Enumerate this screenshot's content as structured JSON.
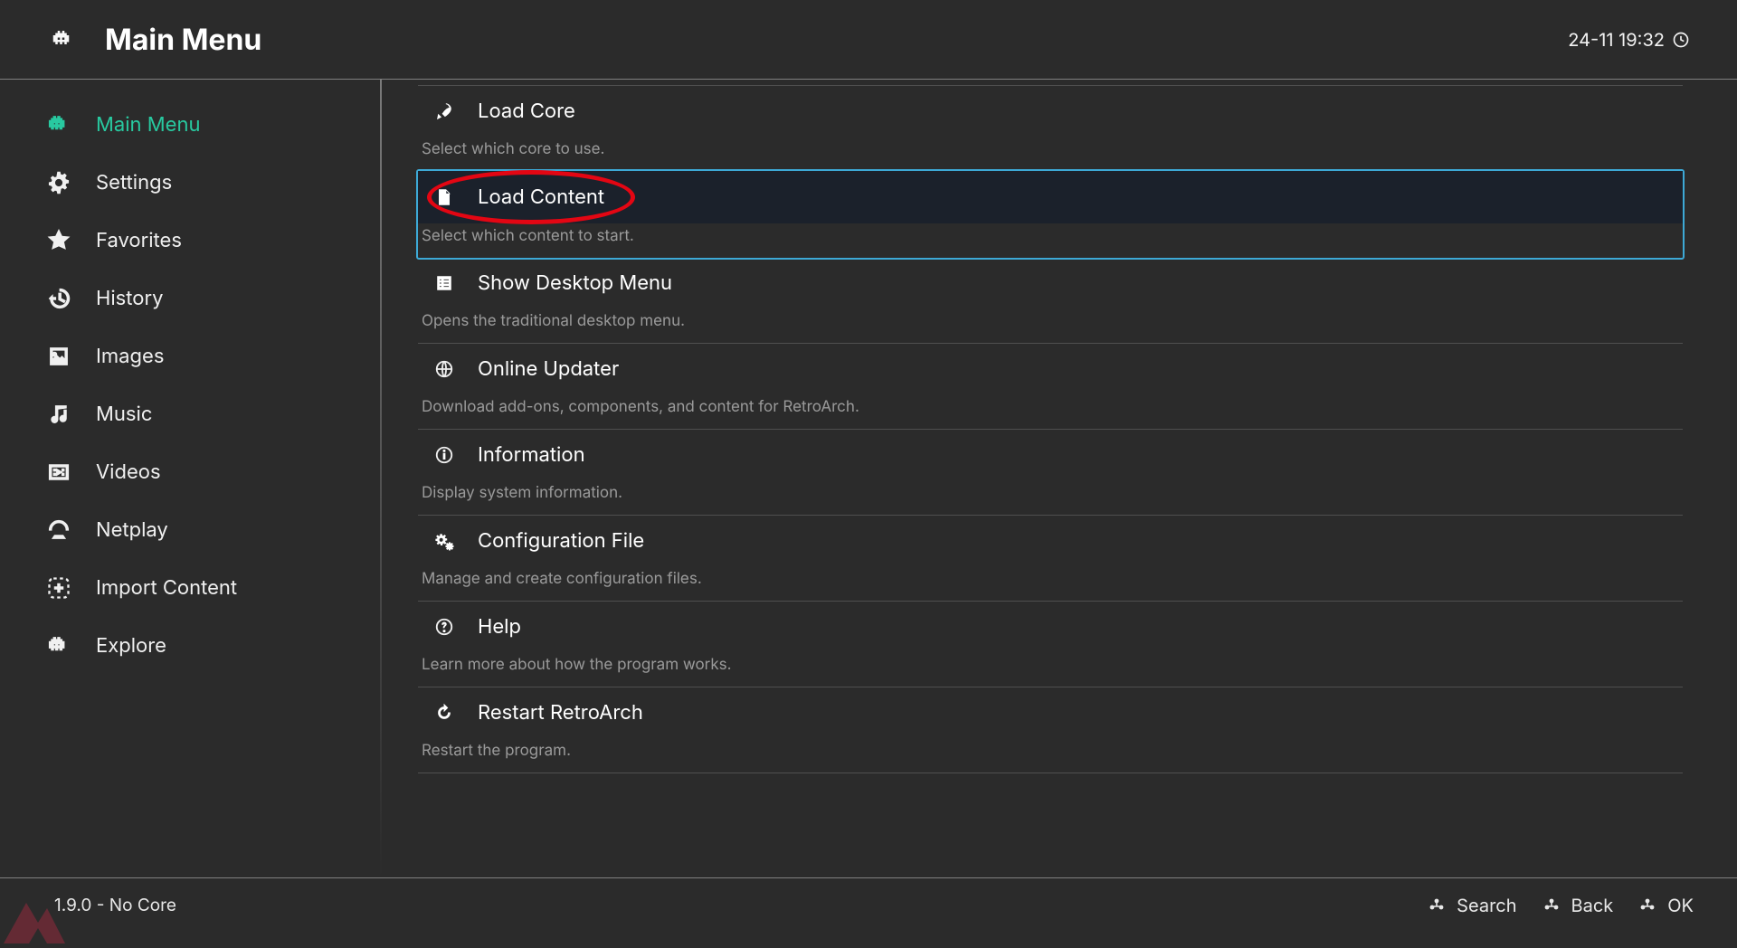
{
  "header": {
    "title": "Main Menu",
    "datetime": "24-11 19:32"
  },
  "sidebar": {
    "items": [
      {
        "label": "Main Menu",
        "icon": "invader-icon",
        "active": true
      },
      {
        "label": "Settings",
        "icon": "gear-icon",
        "active": false
      },
      {
        "label": "Favorites",
        "icon": "star-icon",
        "active": false
      },
      {
        "label": "History",
        "icon": "history-icon",
        "active": false
      },
      {
        "label": "Images",
        "icon": "image-icon",
        "active": false
      },
      {
        "label": "Music",
        "icon": "music-icon",
        "active": false
      },
      {
        "label": "Videos",
        "icon": "video-icon",
        "active": false
      },
      {
        "label": "Netplay",
        "icon": "netplay-icon",
        "active": false
      },
      {
        "label": "Import Content",
        "icon": "plus-box-icon",
        "active": false
      },
      {
        "label": "Explore",
        "icon": "invader-icon",
        "active": false
      }
    ]
  },
  "menu": [
    {
      "title": "Load Core",
      "desc": "Select which core to use.",
      "icon": "rocket-icon",
      "selected": false,
      "highlighted": false
    },
    {
      "title": "Load Content",
      "desc": "Select which content to start.",
      "icon": "file-icon",
      "selected": true,
      "highlighted": true
    },
    {
      "title": "Show Desktop Menu",
      "desc": "Opens the traditional desktop menu.",
      "icon": "list-box-icon",
      "selected": false,
      "highlighted": false
    },
    {
      "title": "Online Updater",
      "desc": "Download add-ons, components, and content for RetroArch.",
      "icon": "globe-icon",
      "selected": false,
      "highlighted": false
    },
    {
      "title": "Information",
      "desc": "Display system information.",
      "icon": "info-icon",
      "selected": false,
      "highlighted": false
    },
    {
      "title": "Configuration File",
      "desc": "Manage and create configuration files.",
      "icon": "gears-icon",
      "selected": false,
      "highlighted": false
    },
    {
      "title": "Help",
      "desc": "Learn more about how the program works.",
      "icon": "help-icon",
      "selected": false,
      "highlighted": false
    },
    {
      "title": "Restart RetroArch",
      "desc": "Restart the program.",
      "icon": "restart-icon",
      "selected": false,
      "highlighted": false
    }
  ],
  "footer": {
    "status": "1.9.0 - No Core",
    "hints": [
      {
        "label": "Search"
      },
      {
        "label": "Back"
      },
      {
        "label": "OK"
      }
    ]
  },
  "colors": {
    "accent": "#28c9a0",
    "selection_border": "#3da9d6",
    "highlight_red": "#e30613"
  }
}
